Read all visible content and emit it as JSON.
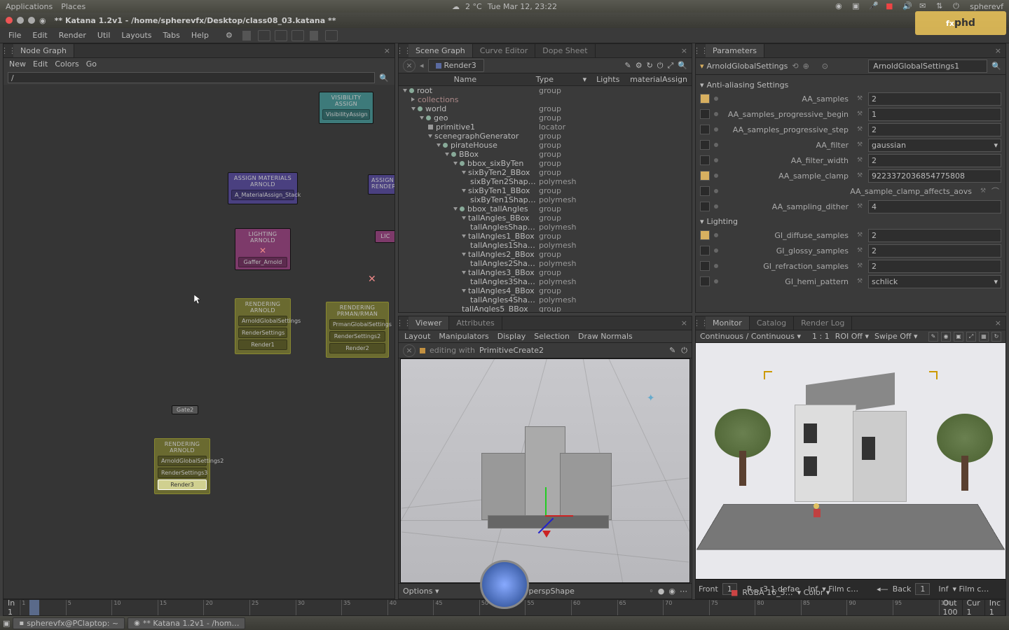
{
  "sys": {
    "apps": "Applications",
    "places": "Places",
    "temp": "2 °C",
    "date": "Tue Mar 12, 23:22",
    "user": "spherevf"
  },
  "title": "** Katana 1.2v1 - /home/spherevfx/Desktop/class08_03.katana **",
  "menu": [
    "File",
    "Edit",
    "Render",
    "Util",
    "Layouts",
    "Tabs",
    "Help"
  ],
  "watermark": "fxphd",
  "nodegraph": {
    "tab": "Node Graph",
    "menu": [
      "New",
      "Edit",
      "Colors",
      "Go"
    ],
    "search": "/",
    "nodes": {
      "vis": {
        "hdr": "VISIBILITY ASSIGN",
        "row": "VisibilityAssign"
      },
      "assignMat": {
        "hdr": "ASSIGN MATERIALS ARNOLD",
        "row": "A_MaterialAssign_Stack"
      },
      "assignRend": {
        "hdr": "ASSIGN RENDER"
      },
      "lighting": {
        "hdr": "LIGHTING ARNOLD",
        "row": "Gaffer_Arnold"
      },
      "lic": {
        "hdr": "LIC"
      },
      "rendA": {
        "hdr": "RENDERING ARNOLD",
        "r1": "ArnoldGlobalSettings",
        "r2": "RenderSettings",
        "r3": "Render1"
      },
      "rendP": {
        "hdr": "RENDERING PRMAN/RMAN",
        "r1": "PrmanGlobalSettings",
        "r2": "RenderSettings2",
        "r3": "Render2"
      },
      "gate": "Gate2",
      "rendB": {
        "hdr": "RENDERING ARNOLD",
        "r1": "ArnoldGlobalSettings2",
        "r2": "RenderSettings3",
        "r3": "Render3"
      }
    }
  },
  "scenegraph": {
    "tabs": [
      "Scene Graph",
      "Curve Editor",
      "Dope Sheet"
    ],
    "node": "Render3",
    "cols": [
      "Name",
      "Type",
      "",
      "Lights",
      "materialAssign"
    ],
    "rows": [
      {
        "d": 0,
        "n": "root",
        "t": "group",
        "o": 1,
        "dot": 1
      },
      {
        "d": 1,
        "n": "collections",
        "t": "",
        "o": 0,
        "c": "#a88"
      },
      {
        "d": 1,
        "n": "world",
        "t": "group",
        "o": 1,
        "dot": 1
      },
      {
        "d": 2,
        "n": "geo",
        "t": "group",
        "o": 1,
        "dot": 1
      },
      {
        "d": 3,
        "n": "primitive1",
        "t": "locator",
        "sq": 1
      },
      {
        "d": 3,
        "n": "scenegraphGenerator",
        "t": "group",
        "o": 1
      },
      {
        "d": 4,
        "n": "pirateHouse",
        "t": "group",
        "o": 1,
        "dot": 1
      },
      {
        "d": 5,
        "n": "BBox",
        "t": "group",
        "o": 1,
        "dot": 1
      },
      {
        "d": 6,
        "n": "bbox_sixByTen",
        "t": "group",
        "o": 1,
        "dot": 1
      },
      {
        "d": 7,
        "n": "sixByTen2_BBox",
        "t": "group",
        "o": 1
      },
      {
        "d": 8,
        "n": "sixByTen2Shap…",
        "t": "polymesh"
      },
      {
        "d": 7,
        "n": "sixByTen1_BBox",
        "t": "group",
        "o": 1
      },
      {
        "d": 8,
        "n": "sixByTen1Shap…",
        "t": "polymesh"
      },
      {
        "d": 6,
        "n": "bbox_tallAngles",
        "t": "group",
        "o": 1,
        "dot": 1
      },
      {
        "d": 7,
        "n": "tallAngles_BBox",
        "t": "group",
        "o": 1
      },
      {
        "d": 8,
        "n": "tallAnglesShap…",
        "t": "polymesh"
      },
      {
        "d": 7,
        "n": "tallAngles1_BBox",
        "t": "group",
        "o": 1
      },
      {
        "d": 8,
        "n": "tallAngles1Sha…",
        "t": "polymesh"
      },
      {
        "d": 7,
        "n": "tallAngles2_BBox",
        "t": "group",
        "o": 1
      },
      {
        "d": 8,
        "n": "tallAngles2Sha…",
        "t": "polymesh"
      },
      {
        "d": 7,
        "n": "tallAngles3_BBox",
        "t": "group",
        "o": 1
      },
      {
        "d": 8,
        "n": "tallAngles3Sha…",
        "t": "polymesh"
      },
      {
        "d": 7,
        "n": "tallAngles4_BBox",
        "t": "group",
        "o": 1
      },
      {
        "d": 8,
        "n": "tallAngles4Sha…",
        "t": "polymesh"
      },
      {
        "d": 7,
        "n": "tallAngles5_BBox",
        "t": "group"
      }
    ]
  },
  "params": {
    "tab": "Parameters",
    "crumb": "ArnoldGlobalSettings",
    "field": "ArnoldGlobalSettings1",
    "sec1": "Anti-aliasing Settings",
    "sec2": "Lighting",
    "rows": [
      {
        "on": 1,
        "l": "AA_samples",
        "v": "2"
      },
      {
        "on": 0,
        "l": "AA_samples_progressive_begin",
        "v": "1"
      },
      {
        "on": 0,
        "l": "AA_samples_progressive_step",
        "v": "2"
      },
      {
        "on": 0,
        "l": "AA_filter",
        "v": "gaussian",
        "sel": 1
      },
      {
        "on": 0,
        "l": "AA_filter_width",
        "v": "2"
      },
      {
        "on": 1,
        "l": "AA_sample_clamp",
        "v": "9223372036854775808"
      },
      {
        "on": 0,
        "l": "AA_sample_clamp_affects_aovs",
        "v": "",
        "curve": 1
      },
      {
        "on": 0,
        "l": "AA_sampling_dither",
        "v": "4"
      }
    ],
    "rows2": [
      {
        "on": 1,
        "l": "GI_diffuse_samples",
        "v": "2"
      },
      {
        "on": 0,
        "l": "GI_glossy_samples",
        "v": "2"
      },
      {
        "on": 0,
        "l": "GI_refraction_samples",
        "v": "2"
      },
      {
        "on": 0,
        "l": "GI_hemi_pattern",
        "v": "schlick",
        "sel": 1
      }
    ]
  },
  "viewer": {
    "tabs": [
      "Viewer",
      "Attributes"
    ],
    "menu": [
      "Layout",
      "Manipulators",
      "Display",
      "Selection",
      "Draw Normals"
    ],
    "editing": "editing with",
    "prim": "PrimitiveCreate2",
    "options": "Options",
    "cam": "perspShape"
  },
  "monitor": {
    "tabs": [
      "Monitor",
      "Catalog",
      "Render Log"
    ],
    "mode": "Continuous / Continuous",
    "ratio": "1 : 1",
    "roi": "ROI Off",
    "swipe": "Swipe Off",
    "front": "Front",
    "frontn": "1",
    "info": "R…r3  1.defae",
    "rgba": "RGBA   16_5…",
    "back": "Back",
    "backn": "1",
    "inf": "Inf",
    "filmc": "Film c…",
    "color": "Color"
  },
  "timeline": {
    "in": "In",
    "inv": "1",
    "out": "Out",
    "outv": "100",
    "cur": "Cur",
    "curv": "1",
    "inc": "Inc",
    "incv": "1",
    "ticks": [
      "1",
      "5",
      "10",
      "15",
      "20",
      "25",
      "30",
      "35",
      "40",
      "45",
      "50",
      "55",
      "60",
      "65",
      "70",
      "75",
      "80",
      "85",
      "90",
      "95",
      "100"
    ]
  },
  "taskbar": {
    "t1": "spherevfx@PClaptop: ~",
    "t2": "** Katana 1.2v1 - /hom…"
  }
}
